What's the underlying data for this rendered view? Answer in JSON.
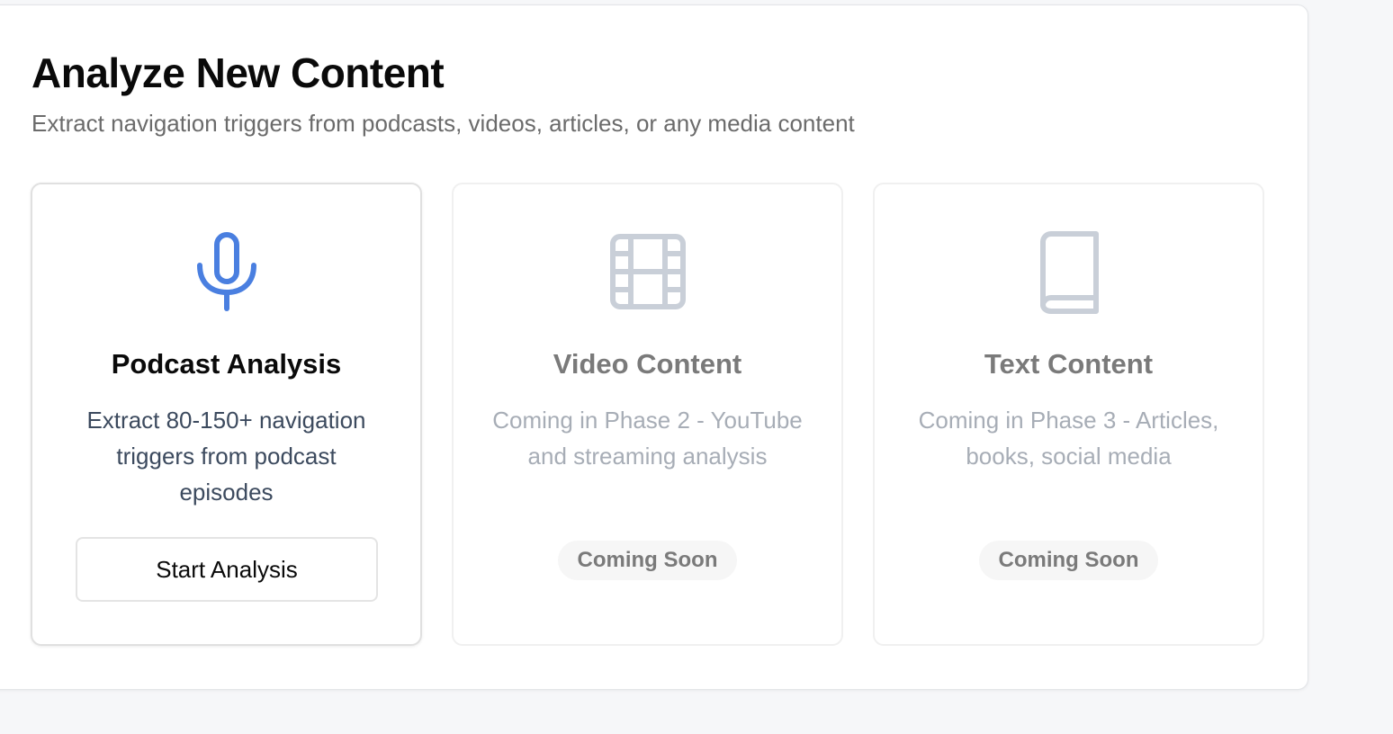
{
  "header": {
    "title": "Analyze New Content",
    "subtitle": "Extract navigation triggers from podcasts, videos, articles, or any media content"
  },
  "cards": [
    {
      "icon": "microphone-icon",
      "title": "Podcast Analysis",
      "description": "Extract 80-150+ navigation triggers from podcast episodes",
      "button_label": "Start Analysis",
      "enabled": true
    },
    {
      "icon": "film-icon",
      "title": "Video Content",
      "description": "Coming in Phase 2 - YouTube and streaming analysis",
      "badge": "Coming Soon",
      "enabled": false
    },
    {
      "icon": "book-icon",
      "title": "Text Content",
      "description": "Coming in Phase 3 - Articles, books, social media",
      "badge": "Coming Soon",
      "enabled": false
    }
  ],
  "colors": {
    "accent": "#4a7fe0",
    "disabled_icon": "#c9cfd8"
  }
}
